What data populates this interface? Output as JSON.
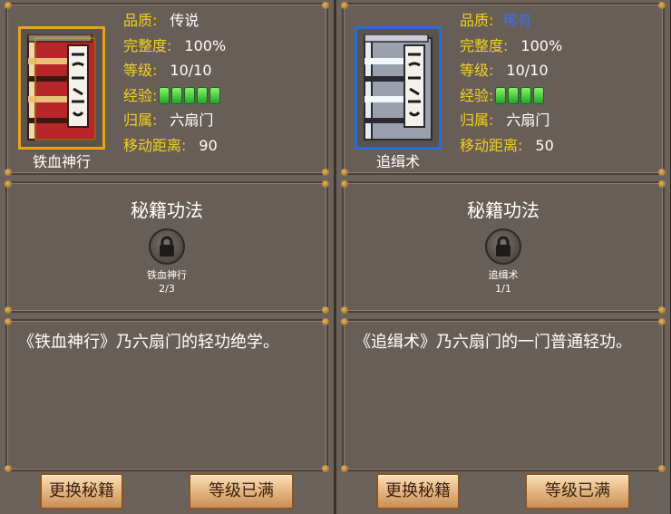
{
  "columns": [
    {
      "book": {
        "name": "铁血神行",
        "rarity": "legendary",
        "frame_color": "#e8a21c",
        "cover_color": "#b8262a",
        "spine_color": "#f0d6a8"
      },
      "stats": {
        "quality_label": "品质:",
        "quality_value": "传说",
        "quality_color": "#ffffff",
        "integrity_label": "完整度:",
        "integrity_value": "100%",
        "level_label": "等级:",
        "level_value": "10/10",
        "exp_label": "经验:",
        "exp_segments": 5,
        "owner_label": "归属:",
        "owner_value": "六扇门",
        "move_label": "移动距离:",
        "move_value": "90"
      },
      "skill": {
        "title": "秘籍功法",
        "icon": "lock-icon",
        "name": "铁血神行",
        "count": "2/3"
      },
      "description": "《铁血神行》乃六扇门的轻功绝学。",
      "buttons": {
        "swap": "更换秘籍",
        "level": "等级已满"
      }
    },
    {
      "book": {
        "name": "追缉术",
        "rarity": "rare",
        "frame_color": "#2a6bd6",
        "cover_color": "#9aa0ac",
        "spine_color": "#e8ecf2"
      },
      "stats": {
        "quality_label": "品质:",
        "quality_value": "稀有",
        "quality_color": "#3e6cf0",
        "integrity_label": "完整度:",
        "integrity_value": "100%",
        "level_label": "等级:",
        "level_value": "10/10",
        "exp_label": "经验:",
        "exp_segments": 4,
        "owner_label": "归属:",
        "owner_value": "六扇门",
        "move_label": "移动距离:",
        "move_value": "50"
      },
      "skill": {
        "title": "秘籍功法",
        "icon": "lock-icon",
        "name": "追缉术",
        "count": "1/1"
      },
      "description": "《追缉术》乃六扇门的一门普通轻功。",
      "buttons": {
        "swap": "更换秘籍",
        "level": "等级已满"
      }
    }
  ]
}
